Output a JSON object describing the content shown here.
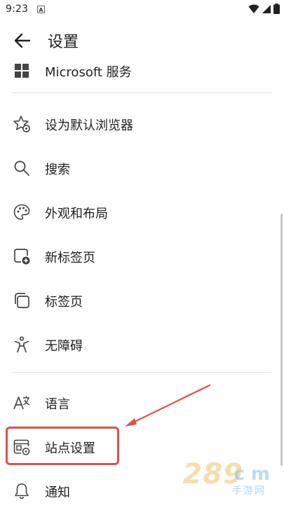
{
  "status_bar": {
    "time": "9:23",
    "notif_letter": "A"
  },
  "header": {
    "title": "设置"
  },
  "items": [
    {
      "label": "Microsoft 服务",
      "icon": "grid-icon"
    },
    {
      "label": "设为默认浏览器",
      "icon": "star-gear-icon"
    },
    {
      "label": "搜索",
      "icon": "search-icon"
    },
    {
      "label": "外观和布局",
      "icon": "palette-icon"
    },
    {
      "label": "新标签页",
      "icon": "new-tab-icon"
    },
    {
      "label": "标签页",
      "icon": "tabs-icon"
    },
    {
      "label": "无障碍",
      "icon": "accessibility-icon"
    },
    {
      "label": "语言",
      "icon": "language-icon"
    },
    {
      "label": "站点设置",
      "icon": "site-settings-icon"
    },
    {
      "label": "通知",
      "icon": "bell-icon"
    }
  ],
  "annotation": {
    "color": "#d9534a"
  },
  "watermark": {
    "main": "289",
    "tail": "c m",
    "sub": "手游网"
  }
}
